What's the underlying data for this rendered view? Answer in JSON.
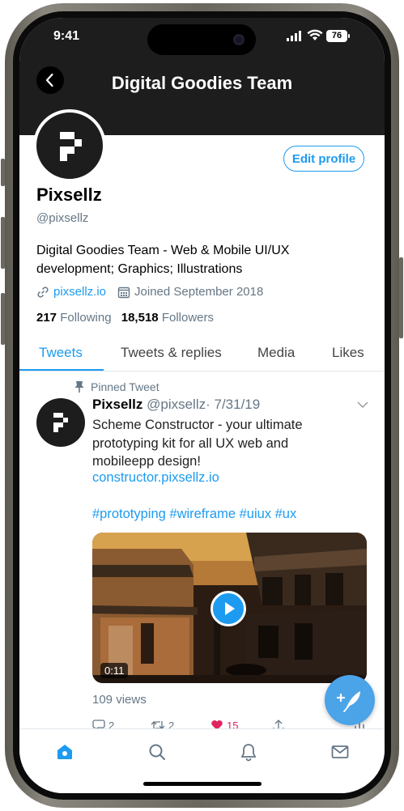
{
  "status_bar": {
    "time": "9:41",
    "battery": "76"
  },
  "header": {
    "title": "Digital Goodies Team"
  },
  "profile": {
    "edit_label": "Edit profile",
    "name": "Pixsellz",
    "handle": "@pixsellz",
    "bio": "Digital Goodies Team - Web & Mobile UI/UX development; Graphics; Illustrations",
    "website": "pixsellz.io",
    "joined": "Joined September 2018",
    "following_count": "217",
    "following_label": "Following",
    "followers_count": "18,518",
    "followers_label": "Followers"
  },
  "tabs": [
    {
      "label": "Tweets",
      "active": true
    },
    {
      "label": "Tweets & replies",
      "active": false
    },
    {
      "label": "Media",
      "active": false
    },
    {
      "label": "Likes",
      "active": false
    }
  ],
  "tweet": {
    "pinned_label": "Pinned Tweet",
    "author_name": "Pixsellz",
    "author_handle": "@pixsellz",
    "date": "· 7/31/19",
    "text": "Scheme Constructor - your ultimate prototyping kit for all UX web and mobileepp design!",
    "link": "constructor.pixsellz.io",
    "hashtags": "#prototyping #wireframe #uiux #ux",
    "video_duration": "0:11",
    "views": "109 views",
    "reply_count": "2",
    "retweet_count": "2",
    "like_count": "15"
  },
  "navbar": {
    "items": [
      "home-icon",
      "search-icon",
      "bell-icon",
      "mail-icon"
    ],
    "active": "home-icon"
  },
  "colors": {
    "accent": "#1d9bf0",
    "header_bg": "#1d1d1d",
    "like": "#e0245e"
  }
}
